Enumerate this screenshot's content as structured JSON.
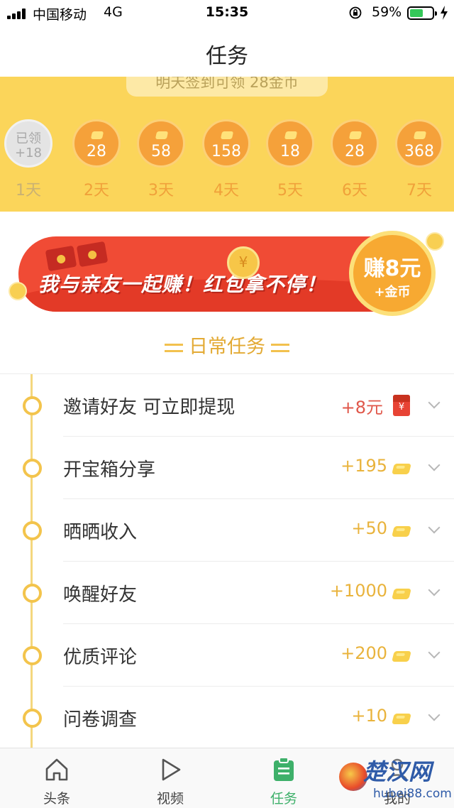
{
  "status_bar": {
    "carrier": "中国移动",
    "network": "4G",
    "time": "15:35",
    "battery_pct": "59%",
    "battery_level": 0.59
  },
  "header": {
    "title": "任务"
  },
  "checkin": {
    "ribbon_text": "明天签到可领 28金币",
    "days": [
      {
        "label": "1天",
        "value": "+18",
        "claimed_text": "已领",
        "claimed": true
      },
      {
        "label": "2天",
        "value": "28",
        "claimed": false
      },
      {
        "label": "3天",
        "value": "58",
        "claimed": false
      },
      {
        "label": "4天",
        "value": "158",
        "claimed": false
      },
      {
        "label": "5天",
        "value": "18",
        "claimed": false
      },
      {
        "label": "6天",
        "value": "28",
        "claimed": false
      },
      {
        "label": "7天",
        "value": "368",
        "claimed": false
      }
    ]
  },
  "banner": {
    "slogan": "我与亲友一起赚！红包拿不停！",
    "amount": "赚8元",
    "sub": "+金币"
  },
  "section": {
    "title": "日常任务"
  },
  "tasks": [
    {
      "name": "邀请好友 可立即提现",
      "reward": "+8元",
      "icon": "red-envelope-icon"
    },
    {
      "name": "开宝箱分享",
      "reward": "+195",
      "icon": "gold-coin-icon"
    },
    {
      "name": "晒晒收入",
      "reward": "+50",
      "icon": "gold-coin-icon"
    },
    {
      "name": "唤醒好友",
      "reward": "+1000",
      "icon": "gold-coin-icon"
    },
    {
      "name": "优质评论",
      "reward": "+200",
      "icon": "gold-coin-icon"
    },
    {
      "name": "问卷调查",
      "reward": "+10",
      "icon": "gold-coin-icon"
    }
  ],
  "tabbar": {
    "tabs": [
      {
        "label": "头条",
        "icon": "home-icon",
        "active": false
      },
      {
        "label": "视频",
        "icon": "play-icon",
        "active": false
      },
      {
        "label": "任务",
        "icon": "clipboard-icon",
        "active": true
      },
      {
        "label": "我的",
        "icon": "user-icon",
        "active": false
      }
    ]
  },
  "watermark": {
    "brand": "楚汉网",
    "domain": "hubei88.com"
  },
  "colors": {
    "checkin_bg": "#fbd55a",
    "coin": "#f5a13a",
    "accent_gold": "#e9b33c",
    "reward_red": "#e0574a",
    "banner_red": "#f04b35",
    "tab_active": "#3eb06a"
  }
}
